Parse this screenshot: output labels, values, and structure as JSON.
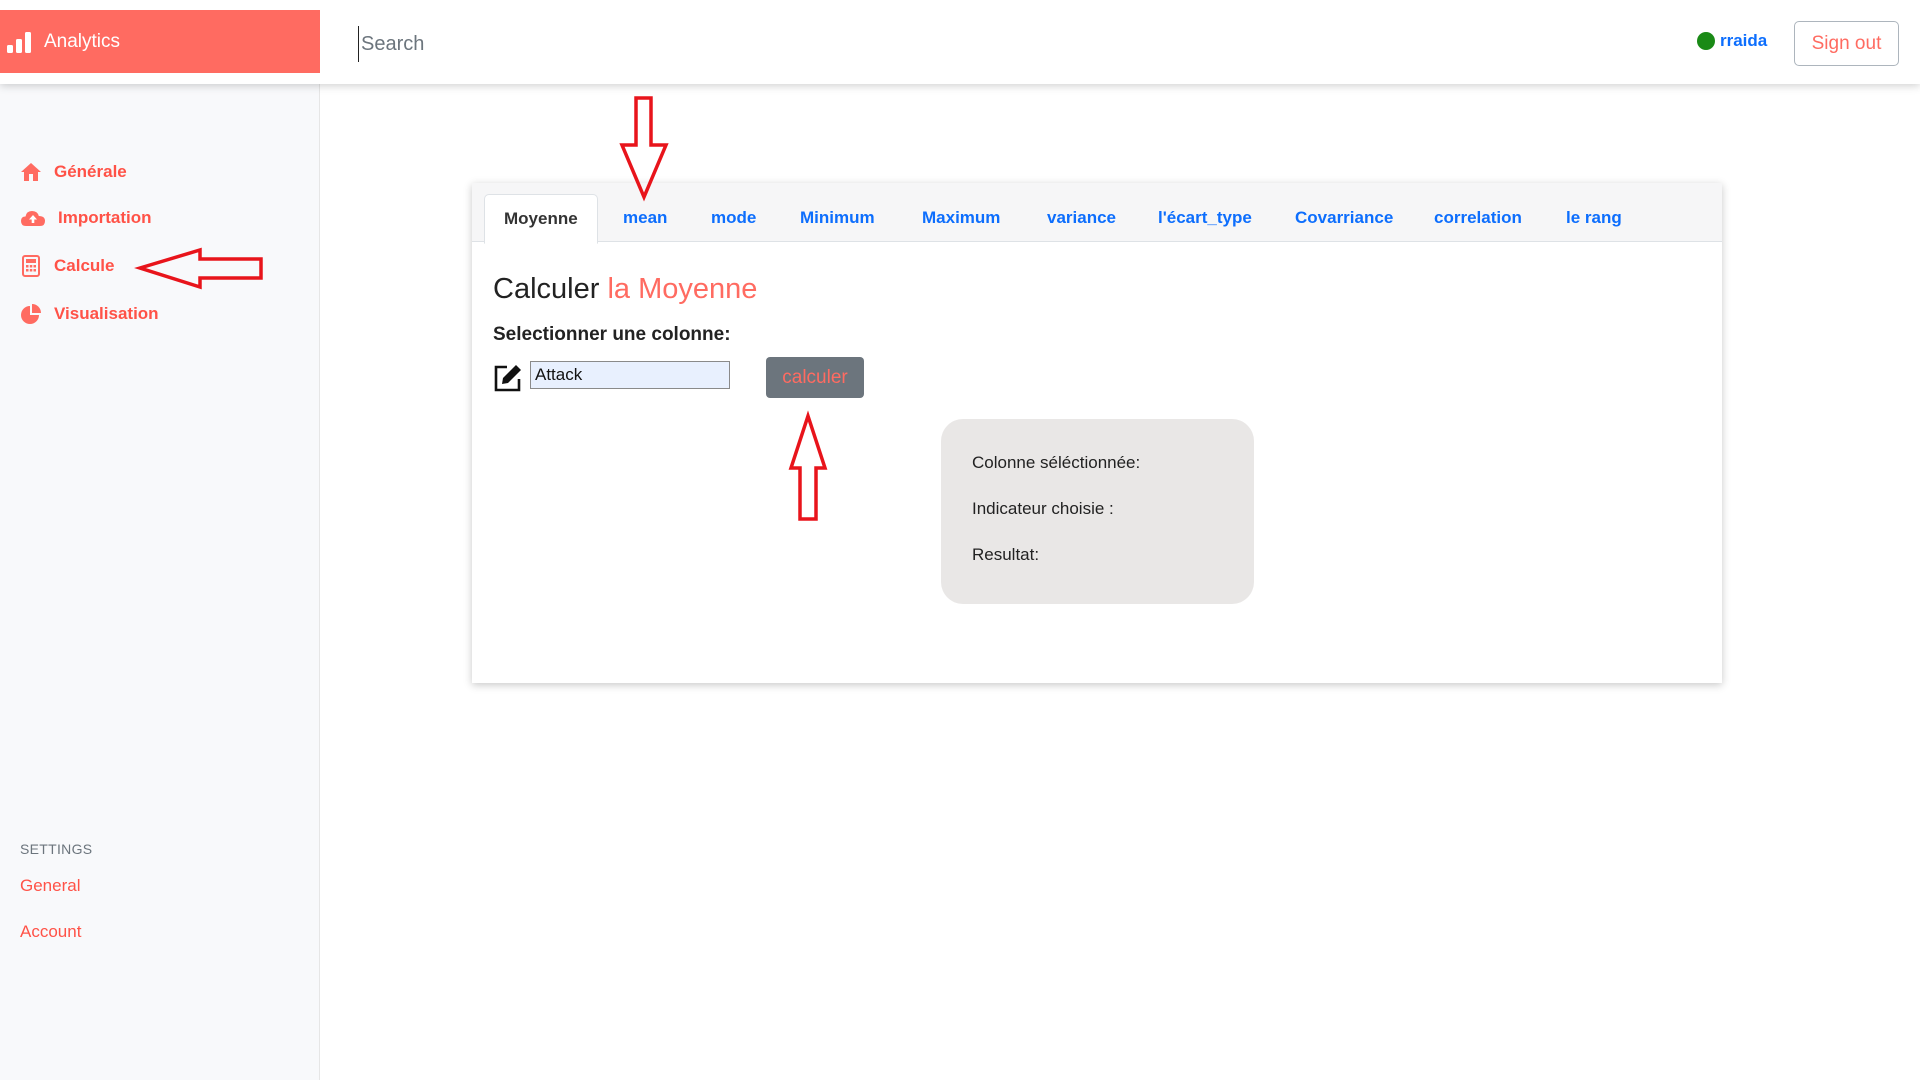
{
  "brand": {
    "title": "Analytics",
    "icon": "bar-chart-icon"
  },
  "search": {
    "placeholder": "Search"
  },
  "user": {
    "name": "rraida",
    "status_color": "#1a8a16"
  },
  "header": {
    "signout_label": "Sign out"
  },
  "colors": {
    "accent": "#ff6b61",
    "link": "#0d6efd"
  },
  "sidebar": {
    "items": [
      {
        "label": "Générale",
        "icon": "home-icon"
      },
      {
        "label": "Importation",
        "icon": "cloud-upload-icon"
      },
      {
        "label": "Calcule",
        "icon": "calculator-icon"
      },
      {
        "label": "Visualisation",
        "icon": "pie-chart-icon"
      }
    ],
    "settings_heading": "SETTINGS",
    "settings_links": [
      "General",
      "Account"
    ]
  },
  "tabs": [
    "Moyenne",
    "mean",
    "mode",
    "Minimum",
    "Maximum",
    "variance",
    "l'écart_type",
    "Covarriance",
    "correlation",
    "le rang"
  ],
  "active_tab": "Moyenne",
  "main": {
    "heading_prefix": "Calculer",
    "heading_accent": "la Moyenne",
    "select_label": "Selectionner une colonne:",
    "column_value": "Attack",
    "calc_button": "calculer",
    "result": {
      "column_label": "Colonne séléctionnée:",
      "indicator_label": "Indicateur choisie :",
      "result_label": "Resultat:"
    }
  }
}
